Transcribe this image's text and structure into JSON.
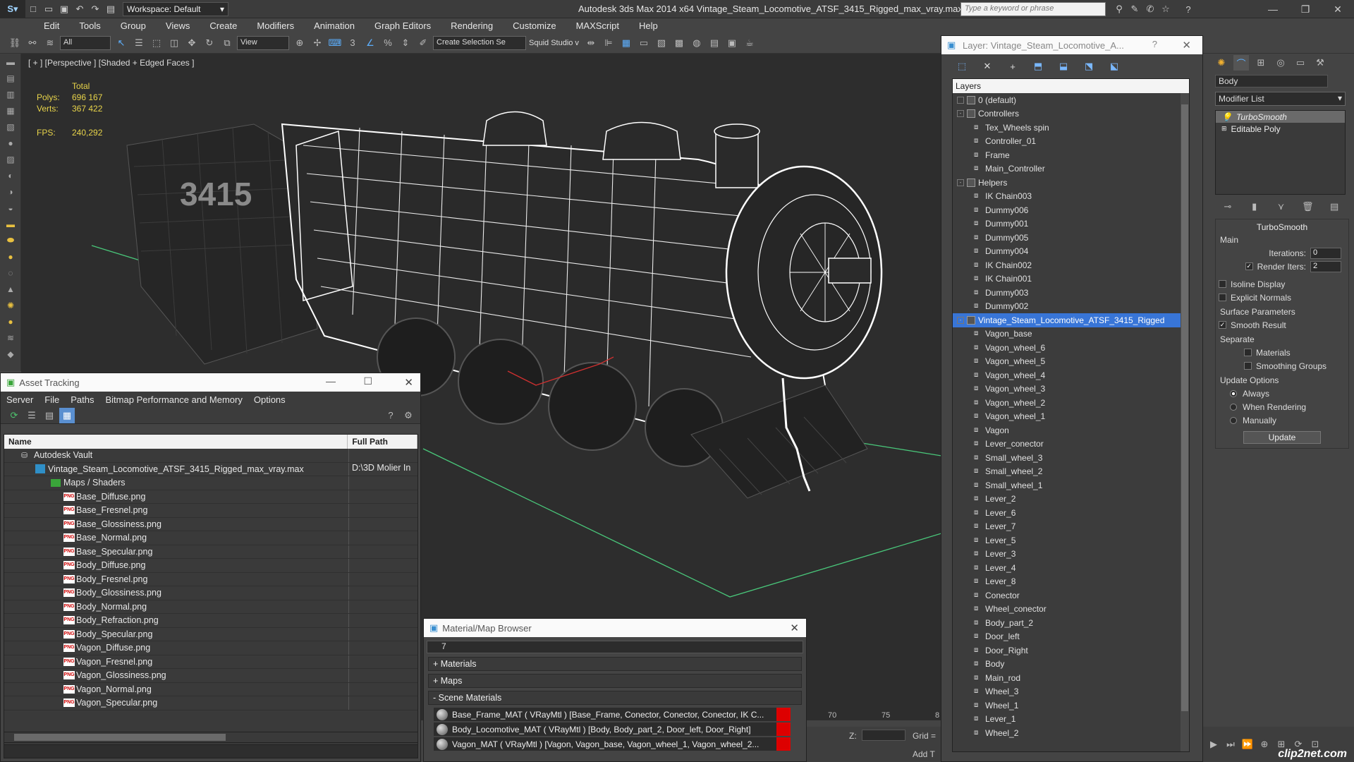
{
  "titlebar": {
    "workspace": "Workspace: Default",
    "title": "Autodesk 3ds Max  2014 x64     Vintage_Steam_Locomotive_ATSF_3415_Rigged_max_vray.max",
    "search_placeholder": "Type a keyword or phrase"
  },
  "menu": [
    "Edit",
    "Tools",
    "Group",
    "Views",
    "Create",
    "Modifiers",
    "Animation",
    "Graph Editors",
    "Rendering",
    "Customize",
    "MAXScript",
    "Help"
  ],
  "toolbar": {
    "filter_value": "All",
    "view_value": "View",
    "selection_set_placeholder": "Create Selection Se",
    "squid": "Squid Studio v"
  },
  "viewport": {
    "label": "[ + ] [Perspective ] [Shaded + Edged Faces ]",
    "stats": {
      "total_label": "Total",
      "polys_label": "Polys:",
      "polys": "696 167",
      "verts_label": "Verts:",
      "verts": "367 422",
      "fps_label": "FPS:",
      "fps": "240,292"
    },
    "loco_number": "3415"
  },
  "asset_tracking": {
    "title": "Asset Tracking",
    "menu": [
      "Server",
      "File",
      "Paths",
      "Bitmap Performance and Memory",
      "Options"
    ],
    "columns": [
      "Name",
      "Full Path"
    ],
    "vault": "Autodesk Vault",
    "max_file": "Vintage_Steam_Locomotive_ATSF_3415_Rigged_max_vray.max",
    "max_path": "D:\\3D Molier In",
    "maps_folder": "Maps / Shaders",
    "files": [
      "Base_Diffuse.png",
      "Base_Fresnel.png",
      "Base_Glossiness.png",
      "Base_Normal.png",
      "Base_Specular.png",
      "Body_Diffuse.png",
      "Body_Fresnel.png",
      "Body_Glossiness.png",
      "Body_Normal.png",
      "Body_Refraction.png",
      "Body_Specular.png",
      "Vagon_Diffuse.png",
      "Vagon_Fresnel.png",
      "Vagon_Glossiness.png",
      "Vagon_Normal.png",
      "Vagon_Specular.png"
    ]
  },
  "material_browser": {
    "title": "Material/Map Browser",
    "search_value": "7",
    "sections": [
      "+ Materials",
      "+ Maps",
      "- Scene Materials"
    ],
    "materials": [
      "Base_Frame_MAT  ( VRayMtl )  [Base_Frame, Conector, Conector, Conector, IK C...",
      "Body_Locomotive_MAT  ( VRayMtl ) [Body, Body_part_2, Door_left, Door_Right]",
      "Vagon_MAT  ( VRayMtl )  [Vagon, Vagon_base, Vagon_wheel_1, Vagon_wheel_2..."
    ]
  },
  "layer_panel": {
    "title": "Layer: Vintage_Steam_Locomotive_A...",
    "help": "?",
    "header": "Layers",
    "rows": [
      {
        "name": "0 (default)",
        "level": 1,
        "kind": "layer",
        "exp": ""
      },
      {
        "name": "Controllers",
        "level": 1,
        "kind": "layer",
        "exp": "-"
      },
      {
        "name": "Tex_Wheels spin",
        "level": 2,
        "kind": "obj",
        "exp": ""
      },
      {
        "name": "Controller_01",
        "level": 2,
        "kind": "obj",
        "exp": ""
      },
      {
        "name": "Frame",
        "level": 2,
        "kind": "obj",
        "exp": ""
      },
      {
        "name": "Main_Controller",
        "level": 2,
        "kind": "obj",
        "exp": ""
      },
      {
        "name": "Helpers",
        "level": 1,
        "kind": "layer",
        "exp": "-"
      },
      {
        "name": "IK Chain003",
        "level": 2,
        "kind": "obj",
        "exp": ""
      },
      {
        "name": "Dummy006",
        "level": 2,
        "kind": "obj",
        "exp": ""
      },
      {
        "name": "Dummy001",
        "level": 2,
        "kind": "obj",
        "exp": ""
      },
      {
        "name": "Dummy005",
        "level": 2,
        "kind": "obj",
        "exp": ""
      },
      {
        "name": "Dummy004",
        "level": 2,
        "kind": "obj",
        "exp": ""
      },
      {
        "name": "IK Chain002",
        "level": 2,
        "kind": "obj",
        "exp": ""
      },
      {
        "name": "IK Chain001",
        "level": 2,
        "kind": "obj",
        "exp": ""
      },
      {
        "name": "Dummy003",
        "level": 2,
        "kind": "obj",
        "exp": ""
      },
      {
        "name": "Dummy002",
        "level": 2,
        "kind": "obj",
        "exp": ""
      },
      {
        "name": "Vintage_Steam_Locomotive_ATSF_3415_Rigged",
        "level": 1,
        "kind": "layer",
        "exp": "-",
        "selected": true
      },
      {
        "name": "Vagon_base",
        "level": 2,
        "kind": "obj",
        "exp": ""
      },
      {
        "name": "Vagon_wheel_6",
        "level": 2,
        "kind": "obj",
        "exp": ""
      },
      {
        "name": "Vagon_wheel_5",
        "level": 2,
        "kind": "obj",
        "exp": ""
      },
      {
        "name": "Vagon_wheel_4",
        "level": 2,
        "kind": "obj",
        "exp": ""
      },
      {
        "name": "Vagon_wheel_3",
        "level": 2,
        "kind": "obj",
        "exp": ""
      },
      {
        "name": "Vagon_wheel_2",
        "level": 2,
        "kind": "obj",
        "exp": ""
      },
      {
        "name": "Vagon_wheel_1",
        "level": 2,
        "kind": "obj",
        "exp": ""
      },
      {
        "name": "Vagon",
        "level": 2,
        "kind": "obj",
        "exp": ""
      },
      {
        "name": "Lever_conector",
        "level": 2,
        "kind": "obj",
        "exp": ""
      },
      {
        "name": "Small_wheel_3",
        "level": 2,
        "kind": "obj",
        "exp": ""
      },
      {
        "name": "Small_wheel_2",
        "level": 2,
        "kind": "obj",
        "exp": ""
      },
      {
        "name": "Small_wheel_1",
        "level": 2,
        "kind": "obj",
        "exp": ""
      },
      {
        "name": "Lever_2",
        "level": 2,
        "kind": "obj",
        "exp": ""
      },
      {
        "name": "Lever_6",
        "level": 2,
        "kind": "obj",
        "exp": ""
      },
      {
        "name": "Lever_7",
        "level": 2,
        "kind": "obj",
        "exp": ""
      },
      {
        "name": "Lever_5",
        "level": 2,
        "kind": "obj",
        "exp": ""
      },
      {
        "name": "Lever_3",
        "level": 2,
        "kind": "obj",
        "exp": ""
      },
      {
        "name": "Lever_4",
        "level": 2,
        "kind": "obj",
        "exp": ""
      },
      {
        "name": "Lever_8",
        "level": 2,
        "kind": "obj",
        "exp": ""
      },
      {
        "name": "Conector",
        "level": 2,
        "kind": "obj",
        "exp": ""
      },
      {
        "name": "Wheel_conector",
        "level": 2,
        "kind": "obj",
        "exp": ""
      },
      {
        "name": "Body_part_2",
        "level": 2,
        "kind": "obj",
        "exp": ""
      },
      {
        "name": "Door_left",
        "level": 2,
        "kind": "obj",
        "exp": ""
      },
      {
        "name": "Door_Right",
        "level": 2,
        "kind": "obj",
        "exp": ""
      },
      {
        "name": "Body",
        "level": 2,
        "kind": "obj",
        "exp": ""
      },
      {
        "name": "Main_rod",
        "level": 2,
        "kind": "obj",
        "exp": ""
      },
      {
        "name": "Wheel_3",
        "level": 2,
        "kind": "obj",
        "exp": ""
      },
      {
        "name": "Wheel_1",
        "level": 2,
        "kind": "obj",
        "exp": ""
      },
      {
        "name": "Lever_1",
        "level": 2,
        "kind": "obj",
        "exp": ""
      },
      {
        "name": "Wheel_2",
        "level": 2,
        "kind": "obj",
        "exp": ""
      }
    ]
  },
  "command_panel": {
    "object_name": "Body",
    "modifier_list": "Modifier List",
    "stack": [
      "TurboSmooth",
      "Editable Poly"
    ],
    "turbosmooth_title": "TurboSmooth",
    "main_label": "Main",
    "iterations_label": "Iterations:",
    "iterations": "0",
    "render_iters_label": "Render Iters:",
    "render_iters": "2",
    "isoline": "Isoline Display",
    "explicit_normals": "Explicit Normals",
    "surface_params": "Surface Parameters",
    "smooth_result": "Smooth Result",
    "separate": "Separate",
    "materials": "Materials",
    "smoothing_groups": "Smoothing Groups",
    "update_options": "Update Options",
    "always": "Always",
    "when_rendering": "When Rendering",
    "manually": "Manually",
    "update_btn": "Update"
  },
  "timeline": {
    "t70": "70",
    "t75": "75",
    "t80": "8"
  },
  "bottom": {
    "z_label": "Z:",
    "grid": "Grid =",
    "add_t": "Add T"
  },
  "watermark": "clip2net.com"
}
